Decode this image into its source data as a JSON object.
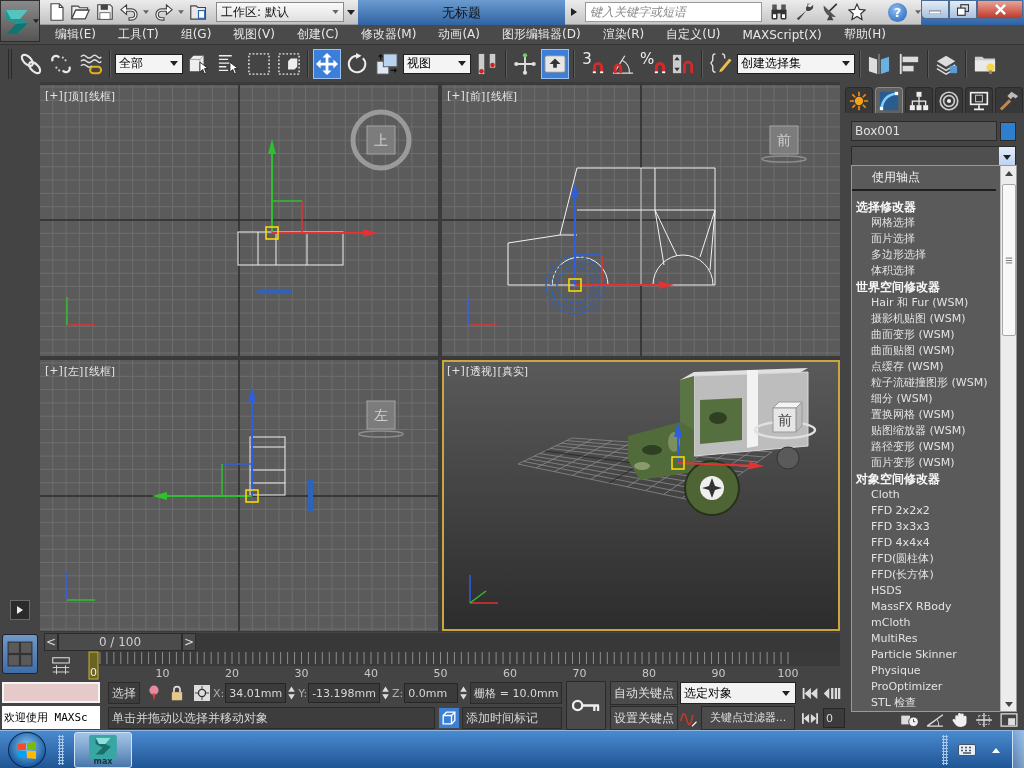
{
  "title_bar": {
    "workspace": "工作区: 默认",
    "title": "无标题",
    "search": {
      "placeholder": "键入关键字或短语"
    },
    "help_glyph": "?"
  },
  "menu": [
    "编辑(E)",
    "工具(T)",
    "组(G)",
    "视图(V)",
    "创建(C)",
    "修改器(M)",
    "动画(A)",
    "图形编辑器(D)",
    "渲染(R)",
    "自定义(U)",
    "MAXScript(X)",
    "帮助(H)"
  ],
  "toolbar": [
    {
      "kind": "button",
      "selected": false
    },
    {
      "kind": "button",
      "selected": false
    },
    {
      "kind": "button",
      "selected": false
    },
    {
      "kind": "dropdown",
      "value": "全部"
    },
    {
      "kind": "button",
      "selected": false
    },
    {
      "kind": "button",
      "selected": false
    },
    {
      "kind": "button",
      "selected": false
    },
    {
      "kind": "button",
      "selected": false
    },
    {
      "kind": "button",
      "selected": true
    },
    {
      "kind": "button",
      "selected": false
    },
    {
      "kind": "button",
      "selected": false
    },
    {
      "kind": "dropdown",
      "value": "视图"
    },
    {
      "kind": "button",
      "selected": false
    },
    {
      "kind": "button",
      "selected": false
    },
    {
      "kind": "button",
      "selected": true
    },
    {
      "kind": "button",
      "selected": false,
      "glyph": "3"
    },
    {
      "kind": "button",
      "selected": false
    },
    {
      "kind": "button",
      "selected": false,
      "glyph": "%"
    },
    {
      "kind": "button",
      "selected": false
    },
    {
      "kind": "button",
      "selected": false
    },
    {
      "kind": "dropdown",
      "value": "创建选择集"
    },
    {
      "kind": "button",
      "selected": false
    },
    {
      "kind": "button",
      "selected": false
    },
    {
      "kind": "button",
      "selected": false
    },
    {
      "kind": "button",
      "selected": false
    }
  ],
  "viewports": [
    {
      "kind": "top",
      "menus": [
        "[+]",
        "[顶]",
        "[线框]"
      ],
      "cube_label": "上",
      "active": false
    },
    {
      "kind": "front",
      "menus": [
        "[+]",
        "[前]",
        "[线框]"
      ],
      "cube_label": "前",
      "active": false
    },
    {
      "kind": "left",
      "menus": [
        "[+]",
        "[左]",
        "[线框]"
      ],
      "cube_label": "左",
      "active": false
    },
    {
      "kind": "perspective",
      "menus": [
        "[+]",
        "[透视]",
        "[真实]"
      ],
      "cube_label": "前",
      "active": true
    }
  ],
  "command_panel": {
    "tabs": [
      {
        "selected": false
      },
      {
        "selected": true
      },
      {
        "selected": false
      },
      {
        "selected": false
      },
      {
        "selected": false
      },
      {
        "selected": false
      }
    ],
    "object": {
      "name": "Box001",
      "color": "#2f7fd1"
    },
    "modifier_list": {
      "expanded": true,
      "items": [
        {
          "kind": "toggle",
          "label": "使用轴点"
        },
        {
          "kind": "header",
          "label": "选择修改器"
        },
        {
          "kind": "item",
          "label": "网格选择"
        },
        {
          "kind": "item",
          "label": "面片选择"
        },
        {
          "kind": "item",
          "label": "多边形选择"
        },
        {
          "kind": "item",
          "label": "体积选择"
        },
        {
          "kind": "header",
          "label": "世界空间修改器"
        },
        {
          "kind": "item",
          "label": "Hair 和 Fur (WSM)"
        },
        {
          "kind": "item",
          "label": "摄影机贴图 (WSM)"
        },
        {
          "kind": "item",
          "label": "曲面变形 (WSM)"
        },
        {
          "kind": "item",
          "label": "曲面贴图 (WSM)"
        },
        {
          "kind": "item",
          "label": "点缓存 (WSM)"
        },
        {
          "kind": "item",
          "label": "粒子流碰撞图形 (WSM)"
        },
        {
          "kind": "item",
          "label": "细分 (WSM)"
        },
        {
          "kind": "item",
          "label": "置换网格 (WSM)"
        },
        {
          "kind": "item",
          "label": "贴图缩放器 (WSM)"
        },
        {
          "kind": "item",
          "label": "路径变形 (WSM)"
        },
        {
          "kind": "item",
          "label": "面片变形 (WSM)"
        },
        {
          "kind": "header",
          "label": "对象空间修改器"
        },
        {
          "kind": "item",
          "label": "Cloth"
        },
        {
          "kind": "item",
          "label": "FFD 2x2x2"
        },
        {
          "kind": "item",
          "label": "FFD 3x3x3"
        },
        {
          "kind": "item",
          "label": "FFD 4x4x4"
        },
        {
          "kind": "item",
          "label": "FFD(圆柱体)"
        },
        {
          "kind": "item",
          "label": "FFD(长方体)"
        },
        {
          "kind": "item",
          "label": "HSDS"
        },
        {
          "kind": "item",
          "label": "MassFX RBody"
        },
        {
          "kind": "item",
          "label": "mCloth"
        },
        {
          "kind": "item",
          "label": "MultiRes"
        },
        {
          "kind": "item",
          "label": "Particle Skinner"
        },
        {
          "kind": "item",
          "label": "Physique"
        },
        {
          "kind": "item",
          "label": "ProOptimizer"
        },
        {
          "kind": "item",
          "label": "STL 检查"
        }
      ]
    }
  },
  "time_slider": {
    "prev": "<",
    "label": "0 / 100",
    "next": ">",
    "level": 0
  },
  "track_bar": {
    "current_frame": "0",
    "ticks": [
      "10",
      "20",
      "30",
      "40",
      "50",
      "60",
      "70",
      "80",
      "90",
      "100"
    ]
  },
  "listener": {
    "output": "欢迎使用 MAXSc"
  },
  "status": {
    "selection": "选择",
    "coords": [
      {
        "label": "X:",
        "value": "34.01mm"
      },
      {
        "label": "Y:",
        "value": "-13.198mm"
      },
      {
        "label": "Z:",
        "value": "0.0mm"
      }
    ],
    "grid": "栅格 = 10.0mm",
    "prompt": "单击并拖动以选择并移动对象",
    "time_tag": "添加时间标记"
  },
  "animation": {
    "auto_key": "自动关键点",
    "set_key": "设置关键点",
    "key_mode": "选定对象",
    "key_filters": "关键点过滤器...",
    "frame": "0"
  },
  "taskbar": {
    "app_label": "max"
  }
}
